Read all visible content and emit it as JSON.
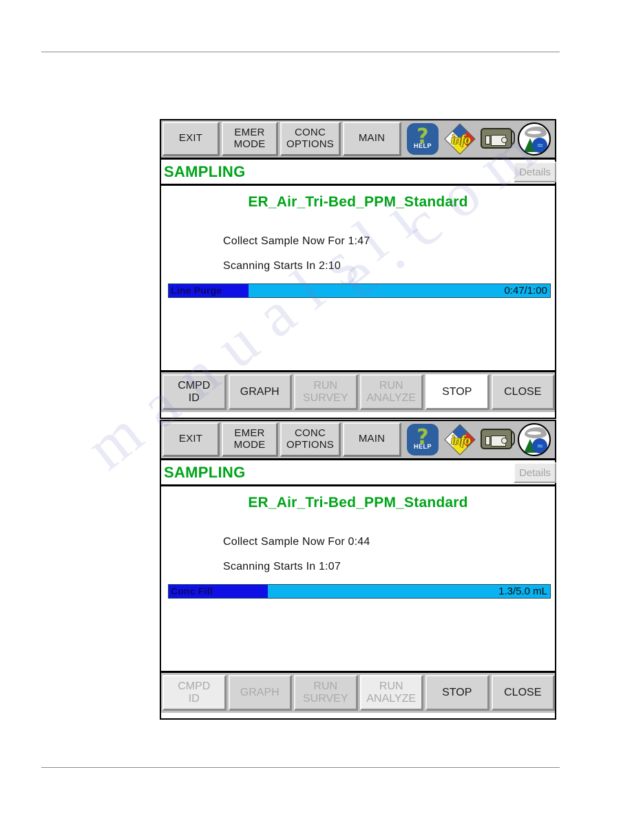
{
  "colors": {
    "green_text": "#00a419",
    "progress_track": "#09b2f0",
    "progress_fill": "#1010e6",
    "button_face": "#d4d4d4",
    "toolbar_bg": "#bfbfbf"
  },
  "toolbar": {
    "buttons": [
      {
        "name": "exit",
        "line1": "EXIT",
        "line2": ""
      },
      {
        "name": "emer-mode",
        "line1": "EMER",
        "line2": "MODE"
      },
      {
        "name": "conc-options",
        "line1": "CONC",
        "line2": "OPTIONS"
      },
      {
        "name": "main",
        "line1": "MAIN",
        "line2": ""
      }
    ],
    "icons": [
      {
        "name": "help-icon",
        "label": "HELP",
        "glyph": "?"
      },
      {
        "name": "info-icon",
        "label": "info"
      },
      {
        "name": "handheld-device-icon",
        "label": ""
      },
      {
        "name": "environment-icon",
        "label": ""
      }
    ]
  },
  "panels": [
    {
      "mode_label": "SAMPLING",
      "details_label": "Details",
      "run_title": "ER_Air_Tri-Bed_PPM_Standard",
      "status_lines": [
        "Collect Sample Now For  1:47",
        "Scanning Starts In  2:10"
      ],
      "progress": {
        "label": "Line Purge",
        "value_text": "0:47/1:00",
        "percent": 21
      },
      "buttons": [
        {
          "name": "cmpd-id",
          "line1": "CMPD",
          "line2": "ID",
          "state": "normal"
        },
        {
          "name": "graph",
          "line1": "GRAPH",
          "line2": "",
          "state": "normal"
        },
        {
          "name": "run-survey",
          "line1": "RUN",
          "line2": "SURVEY",
          "state": "disabled"
        },
        {
          "name": "run-analyze",
          "line1": "RUN",
          "line2": "ANALYZE",
          "state": "disabled"
        },
        {
          "name": "stop",
          "line1": "STOP",
          "line2": "",
          "state": "selected"
        },
        {
          "name": "close",
          "line1": "CLOSE",
          "line2": "",
          "state": "normal"
        }
      ]
    },
    {
      "mode_label": "SAMPLING",
      "details_label": "Details",
      "run_title": "ER_Air_Tri-Bed_PPM_Standard",
      "status_lines": [
        "Collect Sample Now For  0:44",
        "Scanning Starts In  1:07"
      ],
      "progress": {
        "label": "Conc Fill",
        "value_text": "1.3/5.0 mL",
        "percent": 26
      },
      "buttons": [
        {
          "name": "cmpd-id",
          "line1": "CMPD",
          "line2": "ID",
          "state": "sel-disabled"
        },
        {
          "name": "graph",
          "line1": "GRAPH",
          "line2": "",
          "state": "disabled"
        },
        {
          "name": "run-survey",
          "line1": "RUN",
          "line2": "SURVEY",
          "state": "disabled"
        },
        {
          "name": "run-analyze",
          "line1": "RUN",
          "line2": "ANALYZE",
          "state": "sel-disabled"
        },
        {
          "name": "stop",
          "line1": "STOP",
          "line2": "",
          "state": "normal"
        },
        {
          "name": "close",
          "line1": "CLOSE",
          "line2": "",
          "state": "normal"
        }
      ]
    }
  ],
  "watermark": {
    "line_a": "e . c o m",
    "line_b": "m a n u a l s l i"
  }
}
